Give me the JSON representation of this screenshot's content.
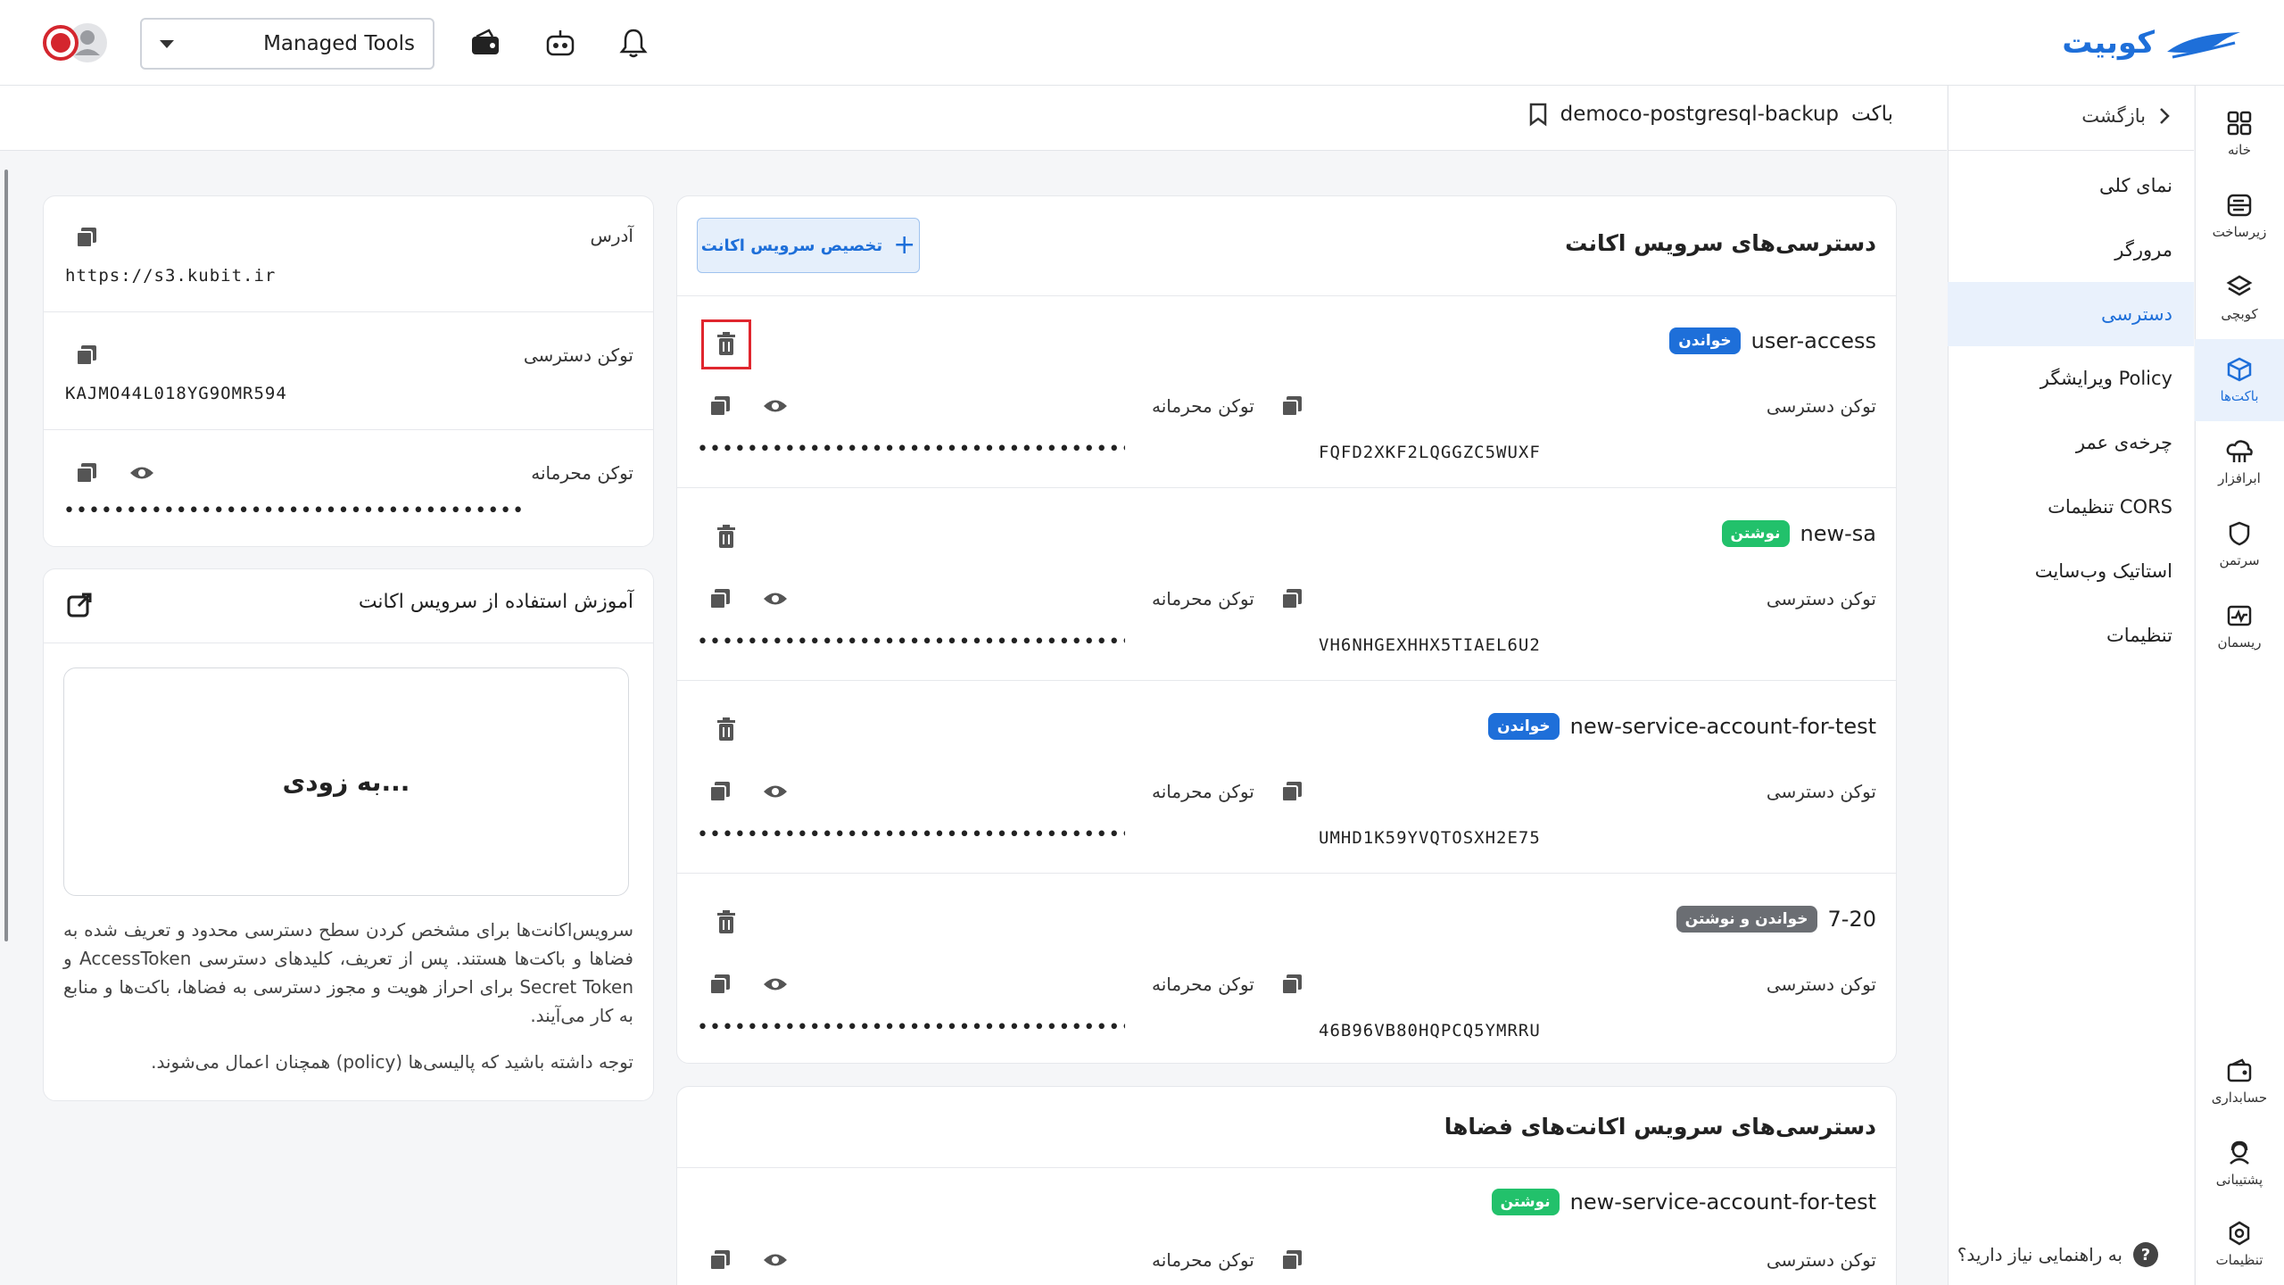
{
  "app": {
    "brand": "کوبیت"
  },
  "topbar": {
    "org_selected": "Managed Tools"
  },
  "rail": [
    {
      "label": "خانه",
      "icon": "grid-icon"
    },
    {
      "label": "زیرساخت",
      "icon": "server-icon"
    },
    {
      "label": "کوبچی",
      "icon": "layers-icon"
    },
    {
      "label": "باکت‌ها",
      "icon": "box-icon",
      "active": true
    },
    {
      "label": "ابرافزار",
      "icon": "cloud-app-icon"
    },
    {
      "label": "سرتمن",
      "icon": "shield-icon"
    },
    {
      "label": "ریسمان",
      "icon": "pulse-icon"
    },
    {
      "label": "حسابداری",
      "icon": "wallet-icon"
    },
    {
      "label": "پشتیبانی",
      "icon": "support-icon"
    },
    {
      "label": "تنظیمات",
      "icon": "gear-icon"
    }
  ],
  "subnav": {
    "back_label": "بازگشت",
    "items": [
      "نمای کلی",
      "مرورگر",
      "دسترسی",
      "ویرایشگر Policy",
      "چرخه‌ی عمر",
      "تنظیمات CORS",
      "استاتیک وب‌سایت",
      "تنظیمات"
    ],
    "help_label": "به راهنمایی نیاز دارید؟"
  },
  "breadcrumb": {
    "prefix": "باکت",
    "name": "democo-postgresql-backup"
  },
  "sa_section": {
    "title": "دسترسی‌های سرویس اکانت",
    "assign_label": "تخصیص سرویس اکانت",
    "access_label": "توکن دسترسی",
    "secret_label": "توکن محرمانه",
    "secret_mask": "••••••••••••••••••••••••••••••••••••••",
    "accounts": [
      {
        "name": "user-access",
        "badge": "خواندن",
        "access_token": "FQFD2XKF2LQGGZC5WUXF"
      },
      {
        "name": "new-sa",
        "badge": "نوشتن",
        "access_token": "VH6NHGEXHHX5TIAEL6U2"
      },
      {
        "name": "new-service-account-for-test",
        "badge": "خواندن",
        "access_token": "UMHD1K59YVQTOSXH2E75"
      },
      {
        "name": "7-20",
        "badge": "خواندن و نوشتن",
        "access_token": "46B96VB80HQPCQ5YMRRU"
      }
    ]
  },
  "space_section": {
    "title": "دسترسی‌های سرویس اکانت‌های فضاها",
    "accounts": [
      {
        "name": "new-service-account-for-test",
        "badge": "نوشتن"
      }
    ]
  },
  "endpoint_card": {
    "address_label": "آدرس",
    "address": "https://s3.kubit.ir",
    "access_label": "توکن دسترسی",
    "access_token": "KAJMO44L018YG9OMR594",
    "secret_label": "توکن محرمانه",
    "secret_mask": "••••••••••••••••••••••••••••••••••••••"
  },
  "tutorial": {
    "title": "آموزش استفاده از سرویس اکانت",
    "coming_soon": "به زودی...",
    "paragraph": "سرویس‌اکانت‌ها برای مشخص کردن سطح دسترسی محدود و تعریف شده به فضاها و باکت‌ها هستند. پس از تعریف، کلیدهای دسترسی AccessToken و Secret Token برای احراز هویت و مجوز دسترسی به فضاها، باکت‌ها و منابع به کار می‌آیند.",
    "note": "توجه داشته باشید که پالیسی‌ها (policy) همچنان اعمال می‌شوند."
  }
}
